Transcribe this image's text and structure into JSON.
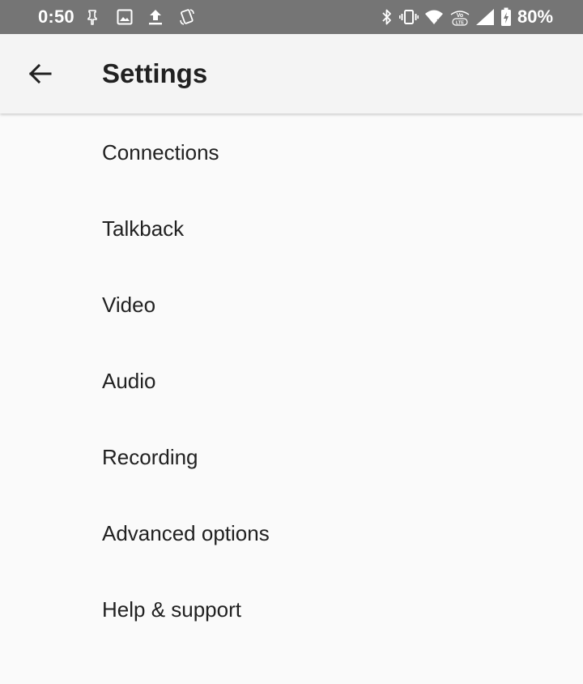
{
  "status_bar": {
    "time": "0:50",
    "battery_percent": "80%",
    "icons_left": [
      "pin-icon",
      "image-icon",
      "upload-icon",
      "screen-rotation-icon"
    ],
    "icons_right": [
      "bluetooth-icon",
      "vibrate-icon",
      "wifi-icon",
      "volte-icon",
      "cell-signal-icon",
      "battery-charging-icon"
    ],
    "background_color": "#757575",
    "text_color": "#ffffff"
  },
  "app_bar": {
    "title": "Settings",
    "back_icon": "arrow-back-icon",
    "background_color": "#f4f4f4"
  },
  "settings": {
    "items": [
      {
        "label": "Connections"
      },
      {
        "label": "Talkback"
      },
      {
        "label": "Video"
      },
      {
        "label": "Audio"
      },
      {
        "label": "Recording"
      },
      {
        "label": "Advanced options"
      },
      {
        "label": "Help & support"
      }
    ]
  }
}
